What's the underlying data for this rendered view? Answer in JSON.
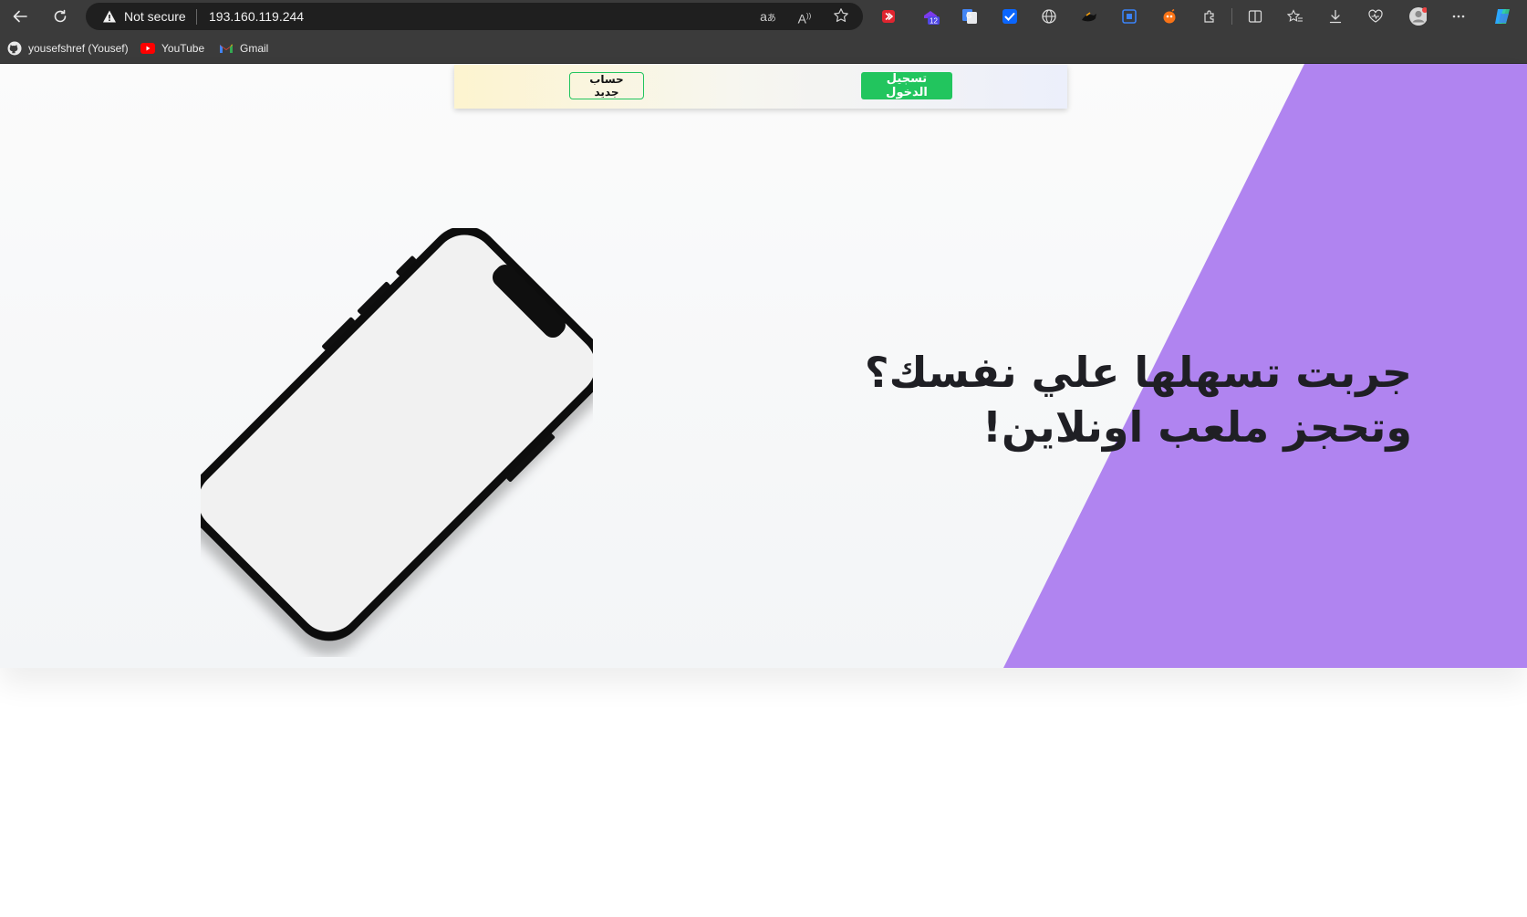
{
  "browser": {
    "security_label": "Not secure",
    "url": "193.160.119.244",
    "extension_badge": "12",
    "toolbar_icons": [
      "back-icon",
      "refresh-icon",
      "translate-icon",
      "read-aloud-icon",
      "favorite-star-icon",
      "split-screen-icon",
      "favorites-icon",
      "download-icon",
      "browser-essentials-icon",
      "profile-icon",
      "more-icon",
      "copilot-icon"
    ]
  },
  "bookmarks": [
    {
      "label": "yousefshref (Yousef)",
      "icon": "github-icon"
    },
    {
      "label": "YouTube",
      "icon": "youtube-icon"
    },
    {
      "label": "Gmail",
      "icon": "gmail-icon"
    }
  ],
  "header": {
    "login_label": "تسجيل الدخول",
    "register_label": "حساب جديد"
  },
  "hero": {
    "headline_line1": "جربت تسهلها علي نفسك؟",
    "headline_line2": "وتحجز ملعب اونلاين!"
  },
  "colors": {
    "accent_purple": "#b084f0",
    "login_green": "#22c55e",
    "headline_text": "#1f1f24"
  }
}
